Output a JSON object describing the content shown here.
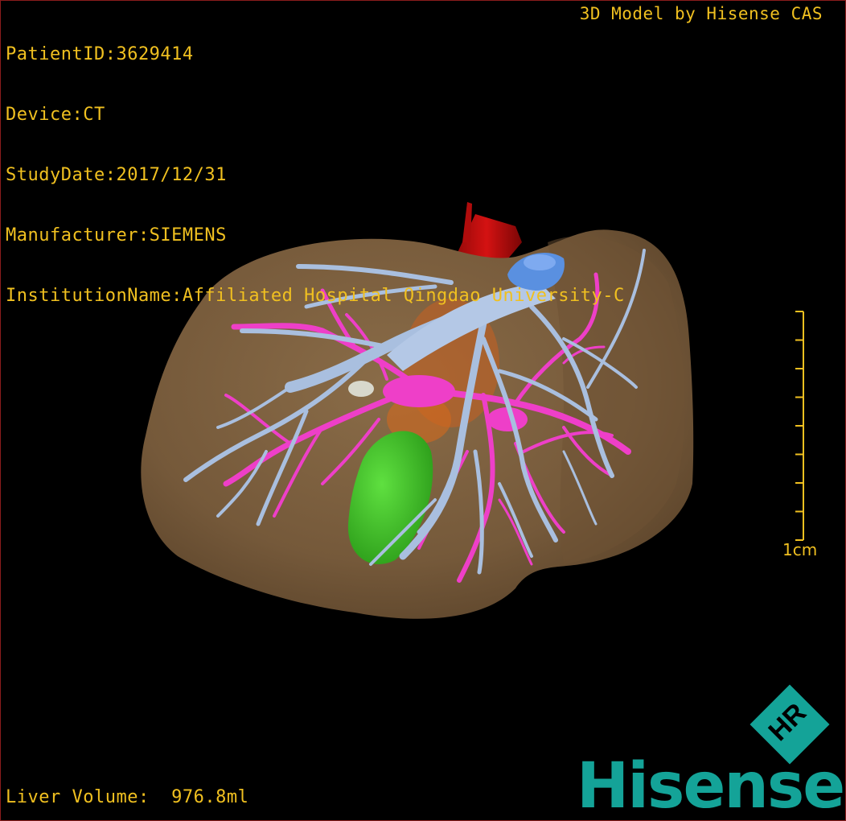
{
  "patient_info": {
    "patient_id": "PatientID:3629414",
    "device": "Device:CT",
    "study_date": "StudyDate:2017/12/31",
    "manufacturer": "Manufacturer:SIEMENS",
    "institution": "InstitutionName:Affiliated Hospital Qingdao University-C"
  },
  "model_credit": "3D Model by Hisense CAS",
  "liver_volume": "Liver Volume:  976.8ml",
  "scale": {
    "label": "1cm",
    "ticks": 9
  },
  "brand": {
    "name": "Hisense",
    "mark": "HR",
    "color": "#14a398"
  },
  "colors": {
    "text": "#f0c020",
    "liver": "#7a5f3f",
    "portal_vein": "#a9bfdf",
    "hepatic_vein": "#ee3fc8",
    "aorta_ivc": "#c01010",
    "ivc_top": "#5a90e0",
    "gallbladder": "#3fc228",
    "orange_structure": "#d2691e"
  }
}
